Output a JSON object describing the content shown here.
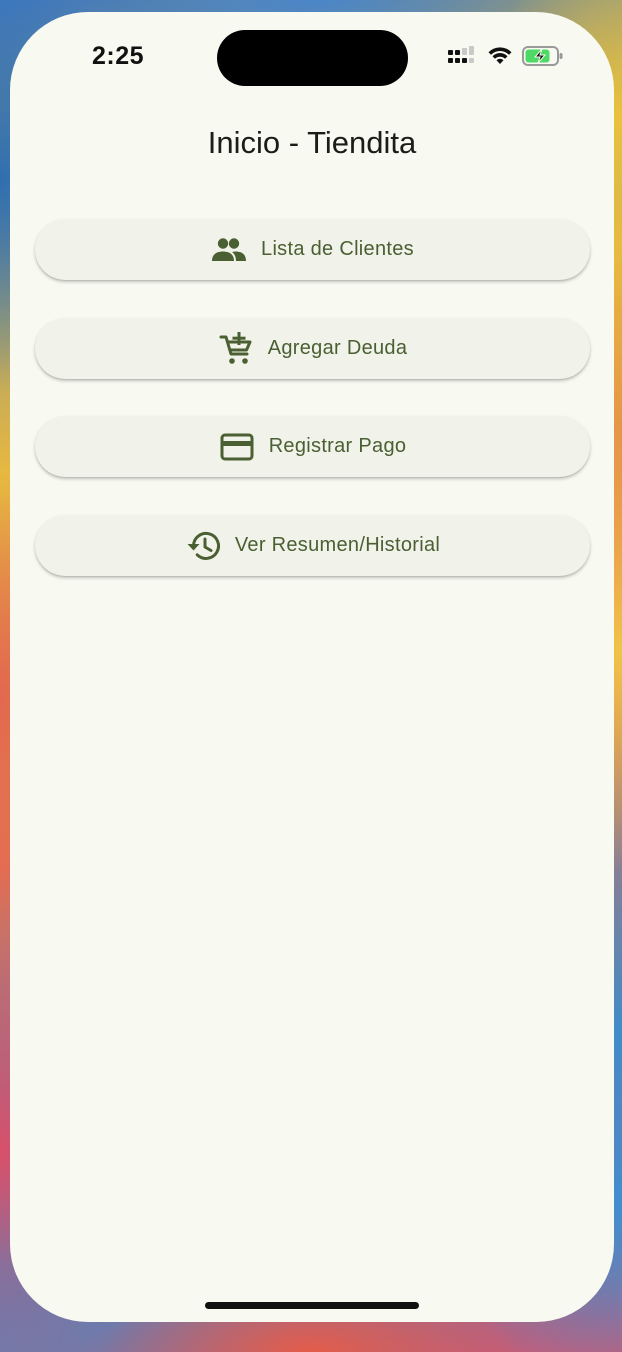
{
  "status_bar": {
    "time": "2:25",
    "icons": [
      "signal-icon",
      "wifi-icon",
      "battery-charging-icon"
    ]
  },
  "app": {
    "title": "Inicio - Tiendita"
  },
  "menu": {
    "buttons": [
      {
        "label": "Lista de Clientes",
        "icon": "people-icon"
      },
      {
        "label": "Agregar Deuda",
        "icon": "add-shopping-cart-icon"
      },
      {
        "label": "Registrar Pago",
        "icon": "credit-card-icon"
      },
      {
        "label": "Ver Resumen/Historial",
        "icon": "history-icon"
      }
    ]
  },
  "colors": {
    "background": "#f8f9f0",
    "button_background": "#f1f2e9",
    "accent": "#4a5f32",
    "title_text": "#1c1d18"
  }
}
